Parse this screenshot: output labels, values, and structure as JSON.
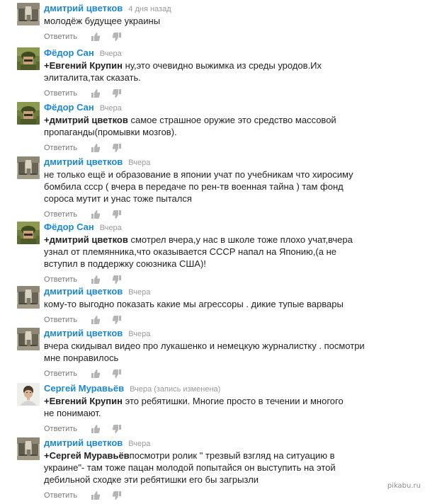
{
  "comments": [
    {
      "author": "дмитрий цветков",
      "time": "4 дня назад",
      "mention": "",
      "text": "молодёж будущее украины",
      "reply": "Ответить",
      "avatar": "dmitry"
    },
    {
      "author": "Фёдор Сан",
      "time": "Вчера",
      "mention": "+Евгений Крупин",
      "text": " ну,это очевидно выжимка из среды уродов.Их элиталита,так сказать.",
      "reply": "Ответить",
      "avatar": "fedor"
    },
    {
      "author": "Фёдор Сан",
      "time": "Вчера",
      "mention": "+дмитрий цветков",
      "text": " самое страшное оружие это средство массовой пропаганды(промывки мозгов).",
      "reply": "Ответить",
      "avatar": "fedor"
    },
    {
      "author": "дмитрий цветков",
      "time": "Вчера",
      "mention": "",
      "text": "не только ещё и образование  в японии учат по учебникам что хиросиму бомбила ссср ( вчера в передаче по рен-тв военная тайна ) там фонд сороса мутит и унас тоже пытался",
      "reply": "Ответить",
      "avatar": "dmitry"
    },
    {
      "author": "Фёдор Сан",
      "time": "Вчера",
      "mention": "+дмитрий цветков",
      "text": " смотрел вчера,у нас в школе тоже плохо учат,вчера узнал от племянника,что оказывается СССР напал на Японию,(а не вступил в поддержку союзника США)!",
      "reply": "Ответить",
      "avatar": "fedor"
    },
    {
      "author": "дмитрий цветков",
      "time": "Вчера",
      "mention": "",
      "text": "кому-то выгодно показать какие мы агрессоры . дикие тупые варвары",
      "reply": "Ответить",
      "avatar": "dmitry"
    },
    {
      "author": "дмитрий цветков",
      "time": "Вчера",
      "mention": "",
      "text": "вчера скидывал видео про лукашенко и немецкую журналистку . посмотри мне понравилось",
      "reply": "Ответить",
      "avatar": "dmitry"
    },
    {
      "author": "Сергей Муравьёв",
      "time": "Вчера (запись изменена)",
      "mention": "+Евгений Крупин",
      "text": " это ребятишки. Многие просто в течении и многого не понимают.",
      "reply": "Ответить",
      "avatar": "sergey"
    },
    {
      "author": "дмитрий цветков",
      "time": "Вчера",
      "mention": "+Сергей Муравьёв",
      "text": "посмотри  ролик \" трезвый взгляд на ситуацию в украине\"- там тоже пацан молодой попытайся он выступить на этой дебильной сходке эти ребятишки его бы загрызли",
      "reply": "Ответить",
      "avatar": "dmitry"
    }
  ],
  "watermark": "pikabu.ru"
}
